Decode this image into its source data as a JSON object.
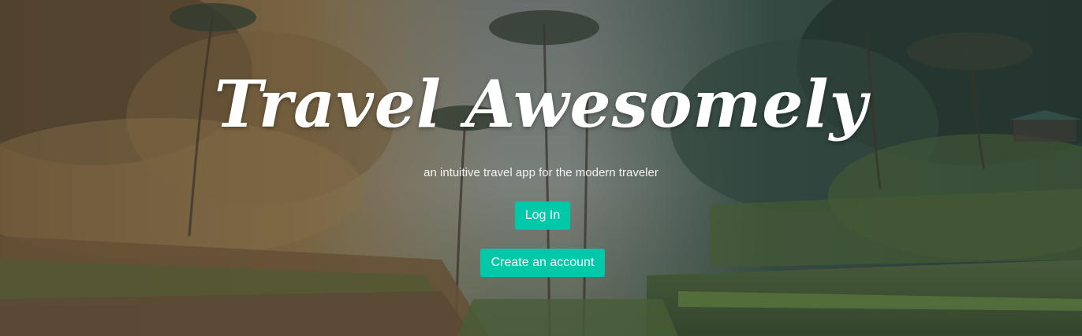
{
  "hero": {
    "title": "Travel Awesomely",
    "subtitle": "an intuitive travel app for the modern traveler",
    "background": "tropical-rice-terrace-photo"
  },
  "actions": {
    "login_label": "Log In",
    "create_account_label": "Create an account"
  },
  "colors": {
    "accent": "#00c8a8",
    "overlay": "#3c3c3c",
    "text": "#ffffff"
  }
}
